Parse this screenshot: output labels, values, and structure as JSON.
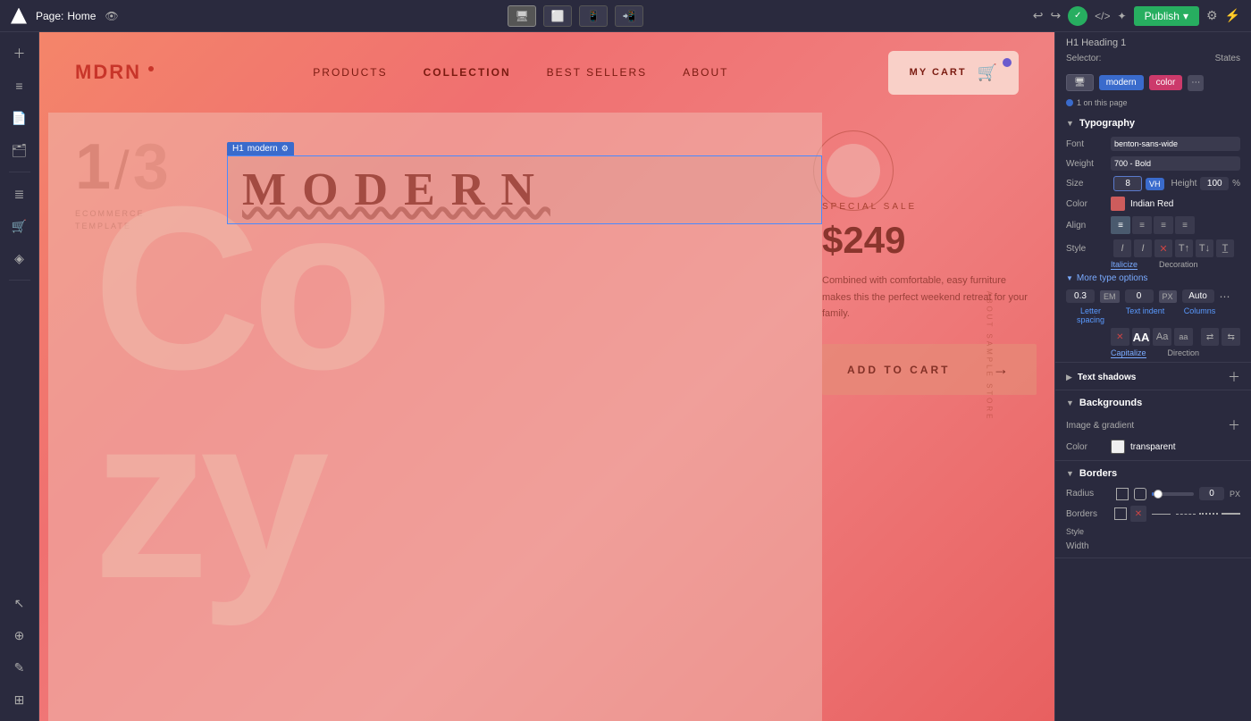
{
  "topbar": {
    "logo": "W",
    "page_label": "Page:",
    "page_name": "Home",
    "publish_label": "Publish",
    "devices": [
      "desktop",
      "tablet-wide",
      "tablet",
      "mobile"
    ],
    "active_device": "desktop"
  },
  "sidebar": {
    "icons": [
      "menu",
      "layers",
      "pages",
      "assets",
      "store",
      "cart",
      "settings",
      "pointer",
      "grid",
      "frame",
      "zoom"
    ]
  },
  "site": {
    "logo": "MDRN",
    "nav_links": [
      "PRODUCTS",
      "COLLECTION",
      "BEST SELLERS",
      "ABOUT"
    ],
    "cart_label": "MY CART",
    "hero_number": "1",
    "hero_slash": "/",
    "hero_number2": "3",
    "hero_sub": "ECOMMERCE\nTEMPLATE",
    "big_text": "Cozy",
    "modern_text": "MODERN",
    "special_sale": "SPECIAL SALE",
    "price": "$249",
    "description": "Combined with comfortable, easy furniture makes this the perfect weekend retreat for your family.",
    "add_to_cart": "ADD TO CART",
    "vertical_text": "ABOUT SAMPLE STORE"
  },
  "element_toolbar": {
    "type": "H1",
    "state": "modern",
    "gear": "⚙"
  },
  "panel": {
    "heading_type": "H1 Heading 1",
    "selector_label": "Selector:",
    "selector_states": "States",
    "btn_monitor": "🖥",
    "btn_modern": "modern",
    "btn_color": "color",
    "on_page": "1 on this page",
    "typography_label": "Typography",
    "font_label": "Font",
    "font_value": "benton-sans-wide",
    "weight_label": "Weight",
    "weight_value": "700 - Bold",
    "size_label": "Size",
    "size_value": "8",
    "size_unit": "VH",
    "height_label": "Height",
    "height_value": "100",
    "height_unit": "%",
    "color_label": "Color",
    "color_value": "Indian Red",
    "color_hex": "#cd5c5c",
    "align_label": "Align",
    "style_label": "Style",
    "italicize_label": "Italicize",
    "decoration_label": "Decoration",
    "more_options_label": "More type options",
    "letter_spacing": "0.3",
    "letter_spacing_unit": "EM",
    "text_indent": "0",
    "text_indent_unit": "PX",
    "columns": "Auto",
    "spacing_labels": [
      "Letter spacing",
      "Text indent",
      "Columns"
    ],
    "capitalize_label": "Capitalize",
    "direction_label": "Direction",
    "text_shadows_label": "Text shadows",
    "backgrounds_label": "Backgrounds",
    "image_gradient_label": "Image & gradient",
    "bg_color_label": "Color",
    "bg_color_value": "transparent",
    "borders_label": "Borders",
    "radius_label": "Radius",
    "radius_value": "0",
    "radius_unit": "PX",
    "borders_sub_label": "Borders",
    "borders_style_label": "Style",
    "width_label": "Width"
  }
}
